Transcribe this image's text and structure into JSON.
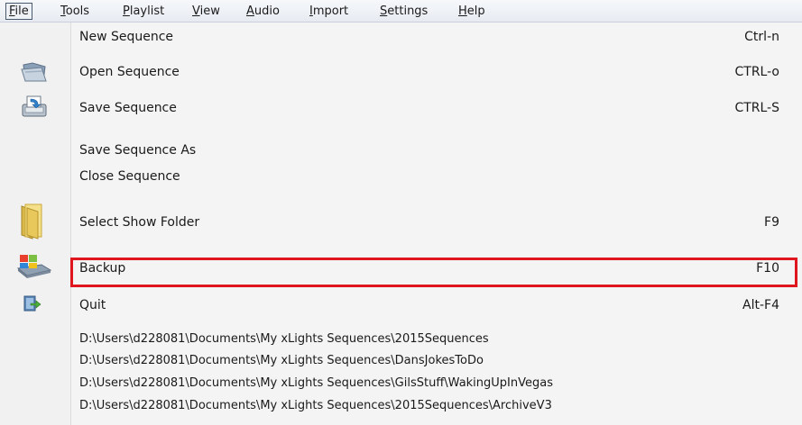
{
  "menubar": {
    "items": [
      {
        "label": "File",
        "mnemonic": "F",
        "rest": "ile"
      },
      {
        "label": "Tools",
        "mnemonic": "T",
        "rest": "ools"
      },
      {
        "label": "Playlist",
        "mnemonic": "P",
        "rest": "laylist"
      },
      {
        "label": "View",
        "mnemonic": "V",
        "rest": "iew"
      },
      {
        "label": "Audio",
        "mnemonic": "A",
        "rest": "udio"
      },
      {
        "label": "Import",
        "mnemonic": "I",
        "rest": "mport"
      },
      {
        "label": "Settings",
        "mnemonic": "S",
        "rest": "ettings"
      },
      {
        "label": "Help",
        "mnemonic": "H",
        "rest": "elp"
      }
    ]
  },
  "file_menu": {
    "items": [
      {
        "label": "New Sequence",
        "shortcut": "Ctrl-n",
        "icon": null
      },
      {
        "label": "Open Sequence",
        "shortcut": "CTRL-o",
        "icon": "open-folder-icon"
      },
      {
        "label": "Save Sequence",
        "shortcut": "CTRL-S",
        "icon": "save-icon"
      },
      {
        "label": "Save Sequence As",
        "shortcut": "",
        "icon": null
      },
      {
        "label": "Close Sequence",
        "shortcut": "",
        "icon": null
      },
      {
        "label": "Select Show Folder",
        "shortcut": "F9",
        "icon": "folder-icon"
      },
      {
        "label": "Backup",
        "shortcut": "F10",
        "icon": "backup-icon",
        "highlighted": true
      },
      {
        "label": "Quit",
        "shortcut": "Alt-F4",
        "icon": "exit-icon"
      }
    ],
    "recent_files": [
      "D:\\Users\\d228081\\Documents\\My xLights Sequences\\2015Sequences",
      "D:\\Users\\d228081\\Documents\\My xLights Sequences\\DansJokesToDo",
      "D:\\Users\\d228081\\Documents\\My xLights Sequences\\GilsStuff\\WakingUpInVegas",
      "D:\\Users\\d228081\\Documents\\My xLights Sequences\\2015Sequences\\ArchiveV3"
    ]
  },
  "colors": {
    "highlight_border": "#e0161e",
    "menu_bg": "#f4f4f4"
  }
}
